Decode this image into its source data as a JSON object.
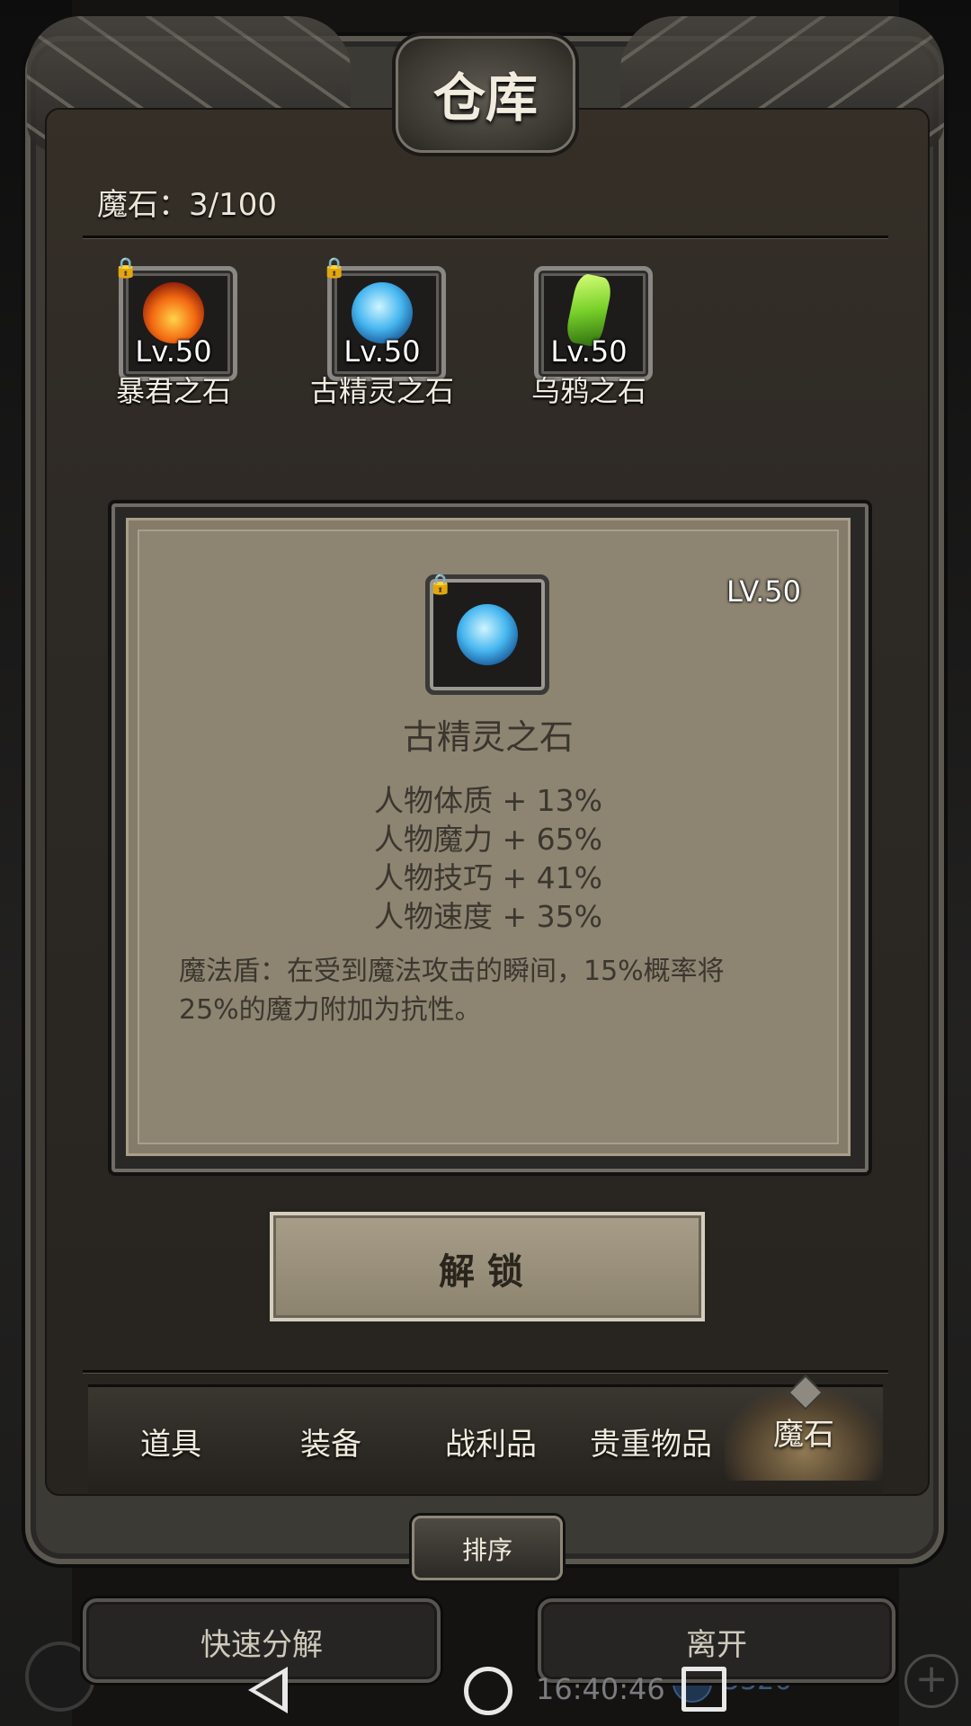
{
  "header": {
    "title": "仓库"
  },
  "inventory": {
    "count_label": "魔石：3/100"
  },
  "stones": [
    {
      "name": "暴君之石",
      "level": "Lv.50",
      "gem_icon": "fire-stone-icon",
      "locked": true
    },
    {
      "name": "古精灵之石",
      "level": "Lv.50",
      "gem_icon": "blue-crystal-icon",
      "locked": true
    },
    {
      "name": "乌鸦之石",
      "level": "Lv.50",
      "gem_icon": "green-crystal-icon",
      "locked": false
    }
  ],
  "detail": {
    "level": "LV.50",
    "name": "古精灵之石",
    "stats": [
      "人物体质 + 13%",
      "人物魔力 + 65%",
      "人物技巧 + 41%",
      "人物速度 + 35%"
    ],
    "description": "魔法盾：在受到魔法攻击的瞬间，15%概率将25%的魔力附加为抗性。"
  },
  "unlock_button": {
    "label": "解锁"
  },
  "tabs": [
    {
      "label": "道具",
      "active": false
    },
    {
      "label": "装备",
      "active": false
    },
    {
      "label": "战利品",
      "active": false
    },
    {
      "label": "贵重物品",
      "active": false
    },
    {
      "label": "魔石",
      "active": true
    }
  ],
  "sort_button": {
    "label": "排序"
  },
  "bottom": {
    "decompose_label": "快速分解",
    "leave_label": "离开",
    "time": "16:40:46",
    "currency": "5326"
  },
  "colors": {
    "panel": "#8d8472",
    "frame": "#3c3a35",
    "text_dark": "#3b362e",
    "text_light": "#f2ede2"
  }
}
